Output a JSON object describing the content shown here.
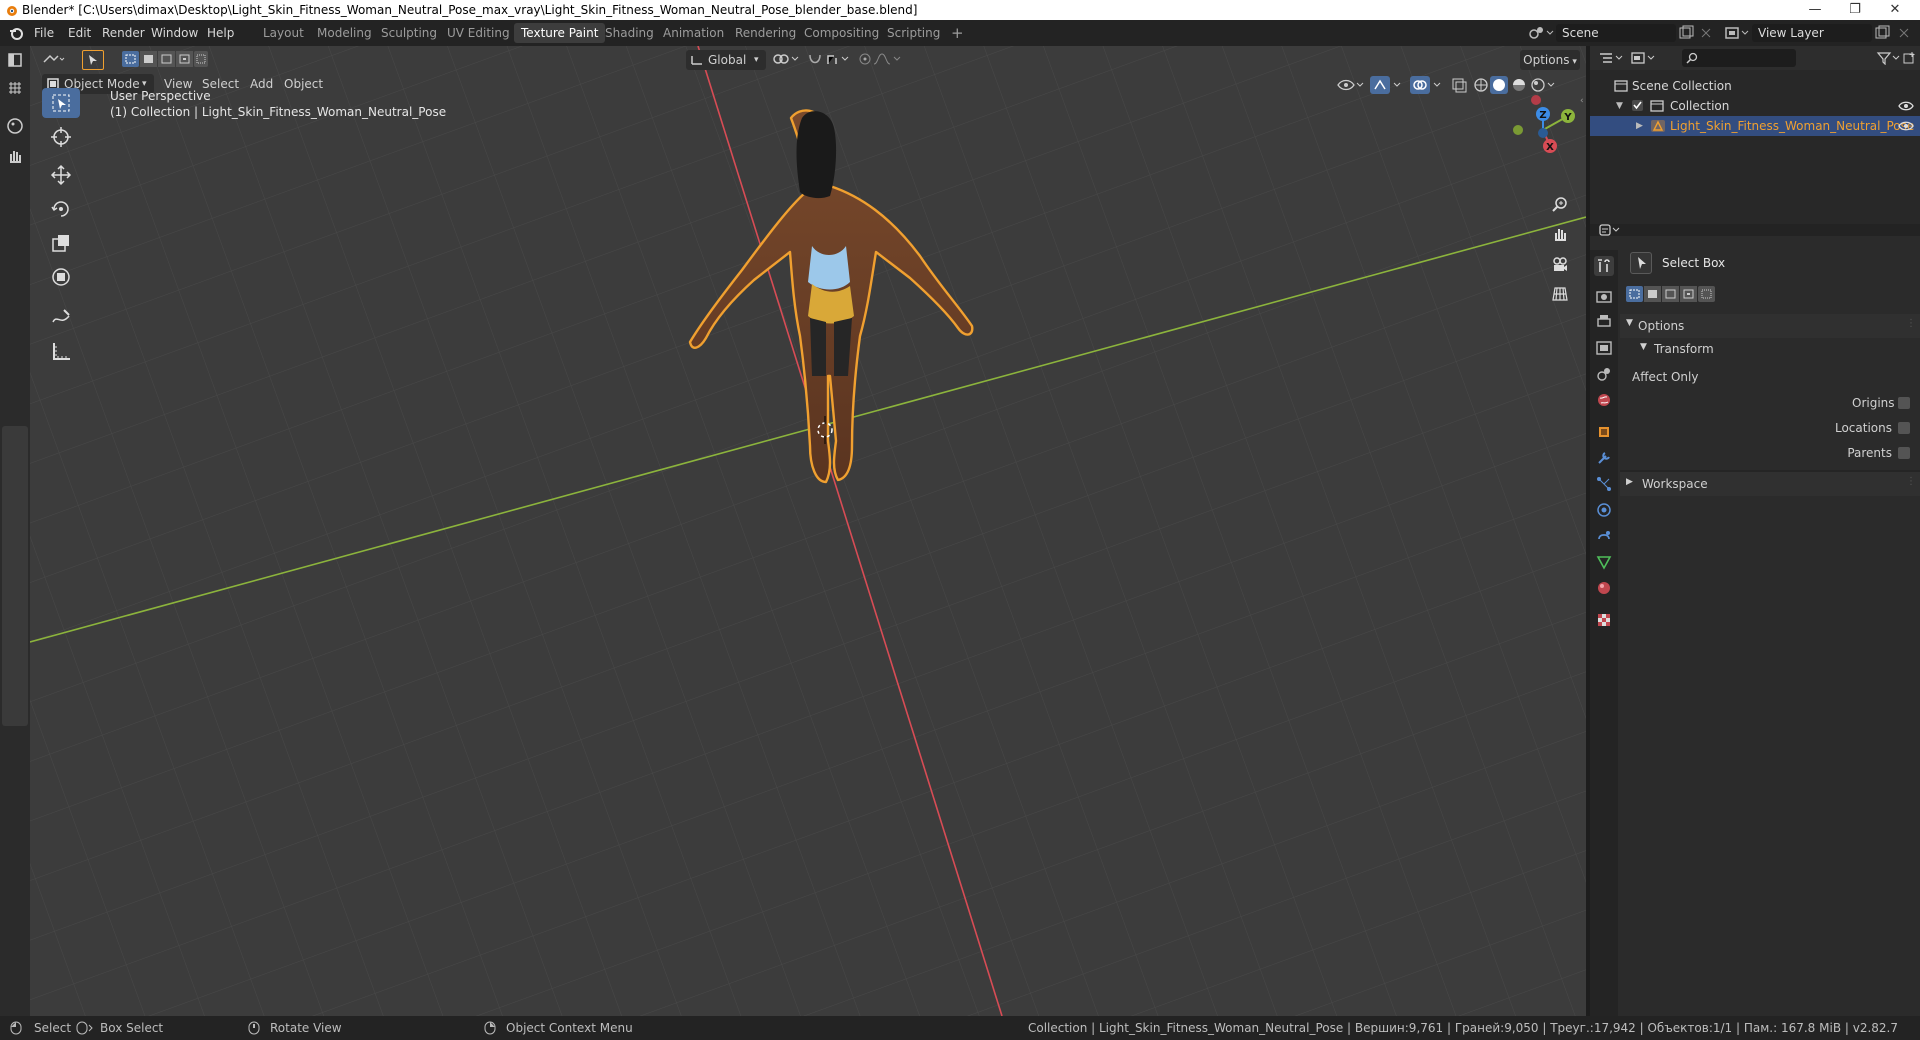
{
  "window": {
    "title": "Blender* [C:\\Users\\dimax\\Desktop\\Light_Skin_Fitness_Woman_Neutral_Pose_max_vray\\Light_Skin_Fitness_Woman_Neutral_Pose_blender_base.blend]",
    "minimize": "—",
    "maximize": "❐",
    "close": "✕"
  },
  "menu": [
    "File",
    "Edit",
    "Render",
    "Window",
    "Help"
  ],
  "workspaces": [
    "Layout",
    "Modeling",
    "Sculpting",
    "UV Editing",
    "Texture Paint",
    "Shading",
    "Animation",
    "Rendering",
    "Compositing",
    "Scripting"
  ],
  "active_workspace": "Texture Paint",
  "add_workspace": "+",
  "scene": {
    "label": "Scene",
    "view_layer": "View Layer"
  },
  "viewport": {
    "mode": "Object Mode",
    "menus": [
      "View",
      "Select",
      "Add",
      "Object"
    ],
    "transform_orientation": "Global",
    "options_label": "Options",
    "overlay_line1": "User Perspective",
    "overlay_line2": "(1) Collection | Light_Skin_Fitness_Woman_Neutral_Pose",
    "gizmo": {
      "z": "Z",
      "y": "Y",
      "x": "X"
    },
    "colors": {
      "x_axis": "#d74c55",
      "y_axis": "#8cb43c",
      "z_axis": "#3c8ce6",
      "selection": "#f0a030"
    }
  },
  "outliner": {
    "scene_collection": "Scene Collection",
    "collection": "Collection",
    "object": "Light_Skin_Fitness_Woman_Neutral_Pose"
  },
  "properties": {
    "tool_name": "Select Box",
    "options_panel": "Options",
    "transform_panel": "Transform",
    "affect_only": "Affect Only",
    "origins": "Origins",
    "locations": "Locations",
    "parents": "Parents",
    "workspace_panel": "Workspace"
  },
  "statusbar": {
    "select": "Select",
    "box_select": "Box Select",
    "rotate_view": "Rotate View",
    "context_menu": "Object Context Menu",
    "stats": "Collection | Light_Skin_Fitness_Woman_Neutral_Pose | Вершин:9,761 | Граней:9,050 | Треуг.:17,942 | Объектов:1/1 | Пам.: 167.8 MiB | v2.82.7"
  }
}
